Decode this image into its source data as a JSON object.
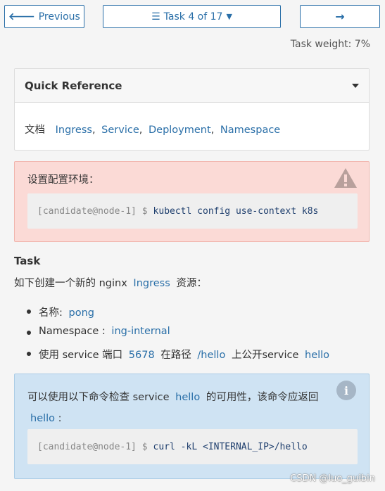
{
  "nav": {
    "previous_label": "Previous",
    "task_label": "Task 4 of 17",
    "next_arrow": "→"
  },
  "task_weight": "Task weight: 7%",
  "quick_reference": {
    "title": "Quick Reference",
    "docs_label": "文档",
    "links": [
      "Ingress",
      "Service",
      "Deployment",
      "Namespace"
    ],
    "separator": ","
  },
  "setup": {
    "text": "设置配置环境：",
    "prompt": "[candidate@node-1] $",
    "command": "kubectl config use-context k8s"
  },
  "task": {
    "heading": "Task",
    "desc_prefix": "如下创建一个新的 nginx",
    "desc_link": "Ingress",
    "desc_suffix": "资源：",
    "items": [
      {
        "label": "名称:",
        "value": "pong"
      },
      {
        "label": "Namespace :",
        "value": "ing-internal"
      },
      {
        "label": "使用 service 端口",
        "port": "5678",
        "mid": "在路径",
        "path": "/hello",
        "mid2": "上公开service",
        "svc": "hello"
      }
    ]
  },
  "check": {
    "text_prefix": "可以使用以下命令检查 service",
    "service": "hello",
    "text_suffix": "的可用性，该命令应返回",
    "return_value": "hello",
    "return_suffix": ":",
    "prompt": "[candidate@node-1] $",
    "command": "curl -kL <INTERNAL_IP>/hello"
  },
  "watermark": "CSDN @luo_guibin",
  "colors": {
    "link": "#2a6fa8",
    "warning_bg": "#fbdad6",
    "info_bg": "#cfe3f3"
  }
}
